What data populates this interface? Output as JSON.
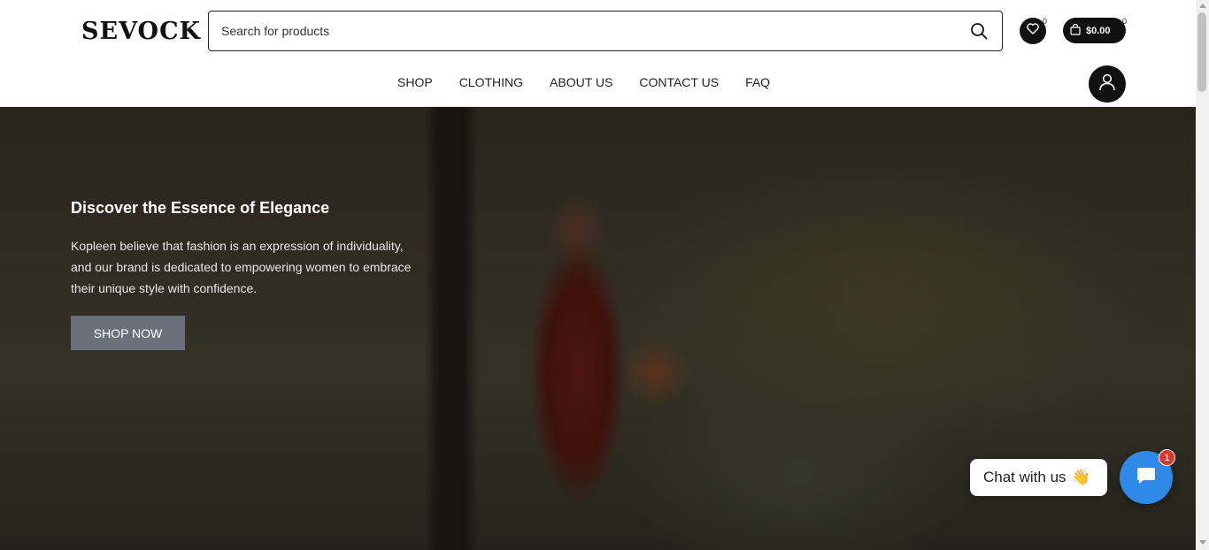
{
  "header": {
    "logo": "SEVOCK",
    "search": {
      "placeholder": "Search for products",
      "value": ""
    },
    "wishlist": {
      "count": "0",
      "icon": "heart-icon"
    },
    "cart": {
      "amount": "$0.00",
      "count": "0",
      "icon": "shopping-bag-icon"
    },
    "account_icon": "user-icon"
  },
  "nav": {
    "items": [
      {
        "label": "SHOP"
      },
      {
        "label": "CLOTHING"
      },
      {
        "label": "ABOUT US"
      },
      {
        "label": "CONTACT US"
      },
      {
        "label": "FAQ"
      }
    ]
  },
  "hero": {
    "title": "Discover the Essence of Elegance",
    "text": "Kopleen believe that fashion is an expression of individuality, and our brand is dedicated to empowering women to embrace their unique style with confidence.",
    "cta_label": "SHOP NOW"
  },
  "chat": {
    "label": "Chat with us",
    "emoji": "👋",
    "badge": "1",
    "icon": "chat-bubble-icon"
  },
  "colors": {
    "accent_dark": "#111111",
    "cta": "#6b717b",
    "chat": "#2e8ae6",
    "badge": "#e0352b"
  }
}
